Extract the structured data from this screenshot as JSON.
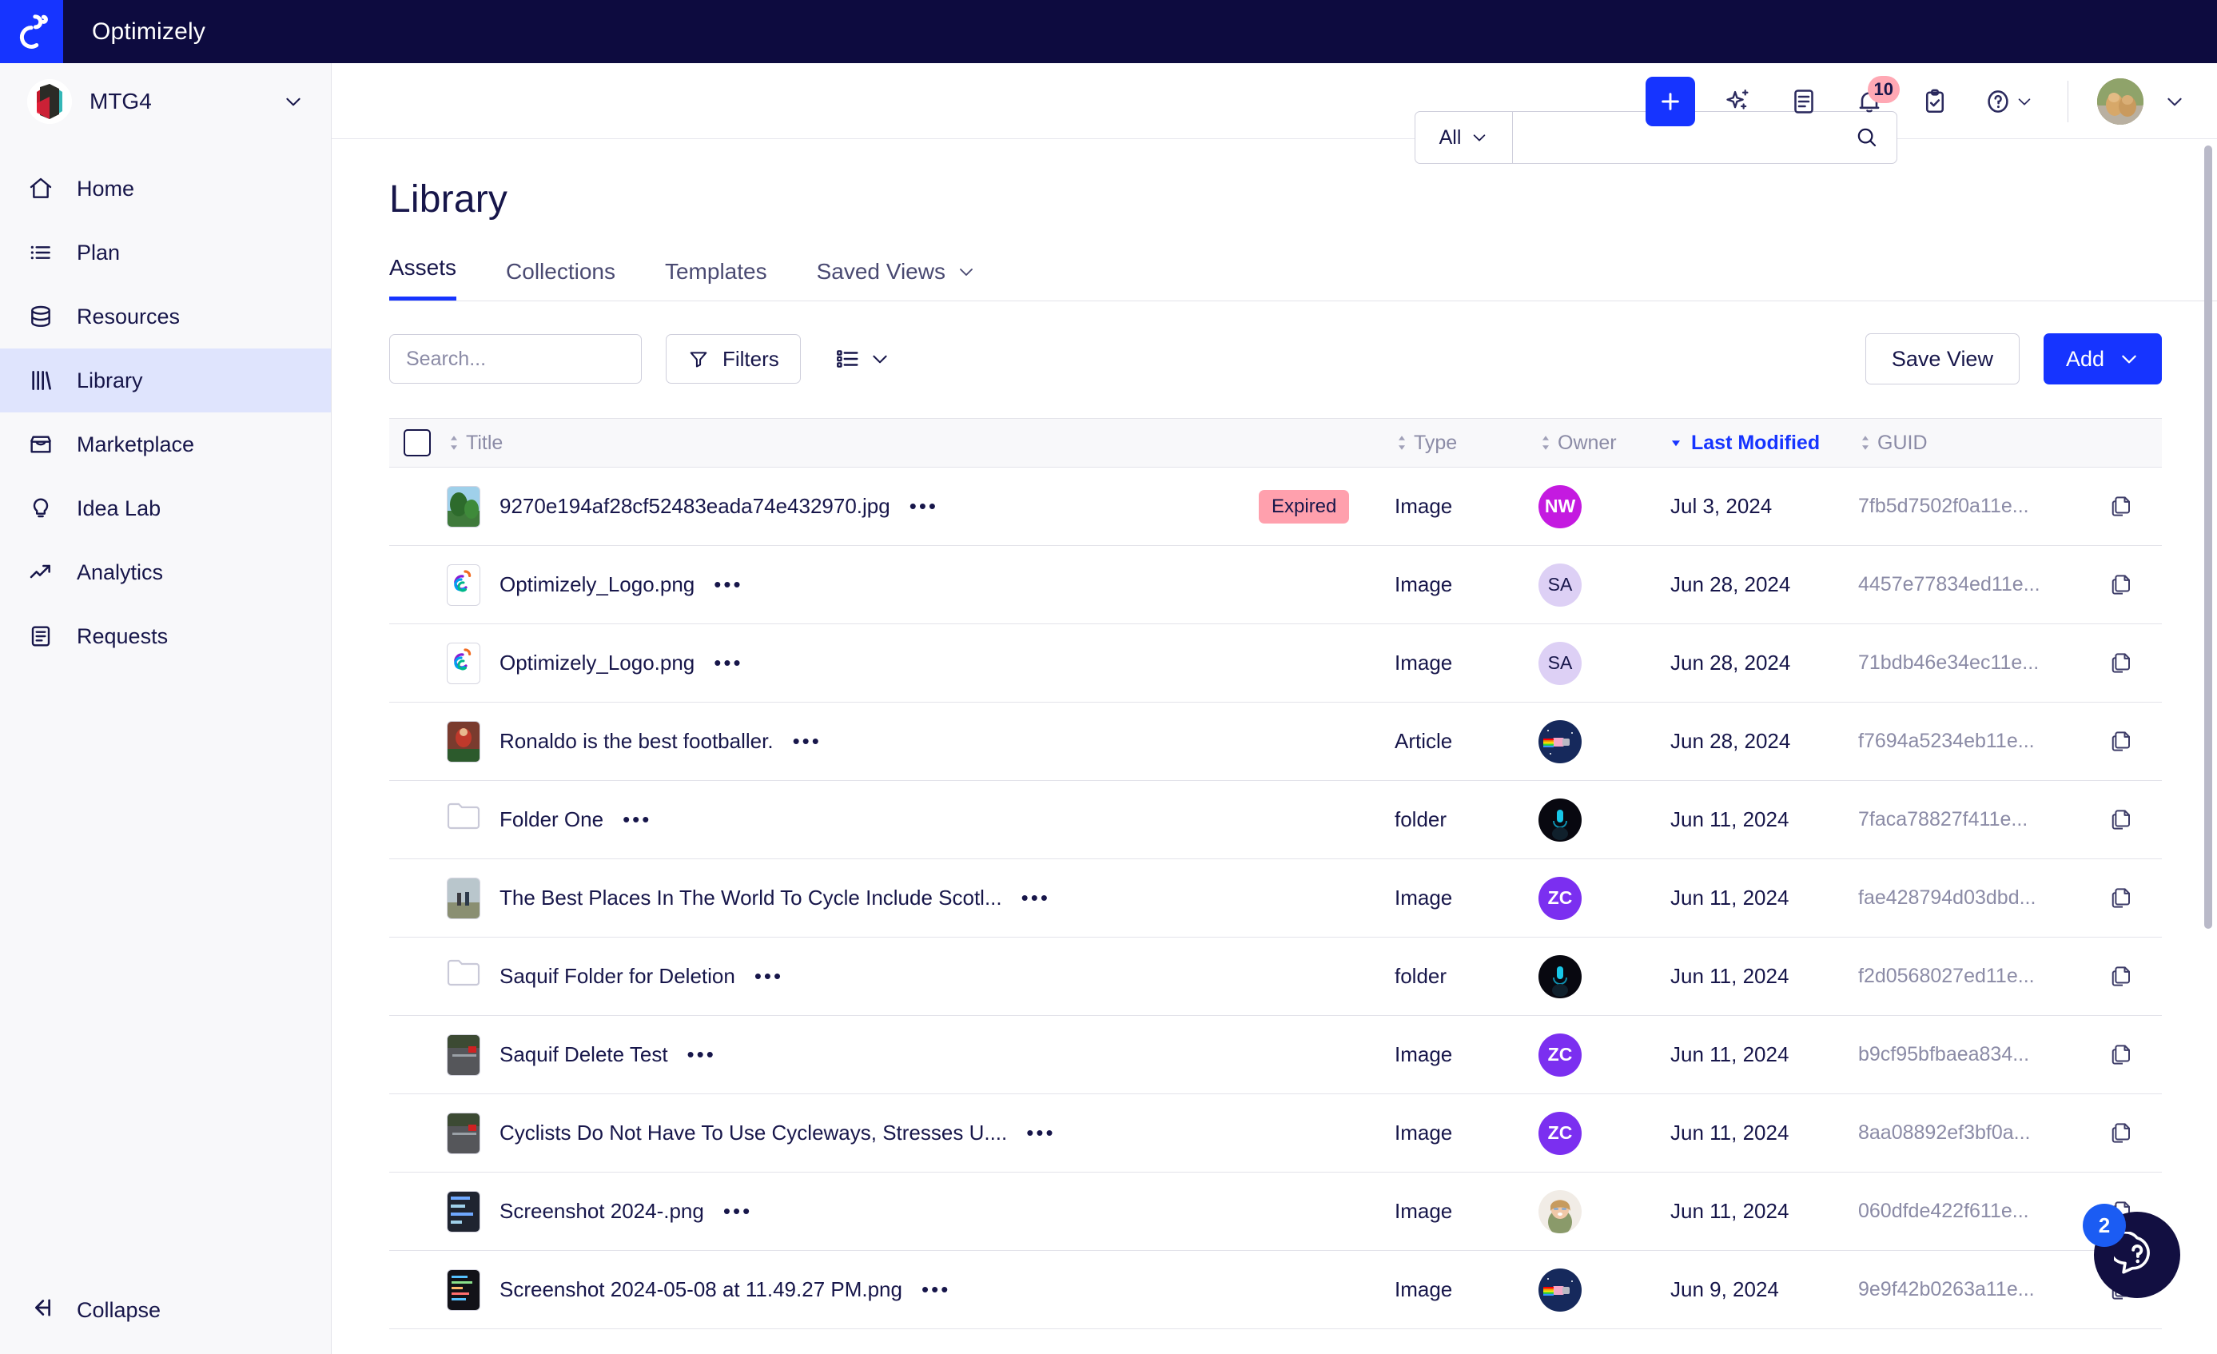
{
  "brand": {
    "name": "Optimizely",
    "logo_icon": "optimizely-logo-icon"
  },
  "org": {
    "name": "MTG4",
    "chevron_icon": "chevron-down-icon",
    "logo_icon": "org-logo-icon"
  },
  "sidebar": {
    "items": [
      {
        "label": "Home",
        "icon": "home-icon",
        "active": false
      },
      {
        "label": "Plan",
        "icon": "list-icon",
        "active": false
      },
      {
        "label": "Resources",
        "icon": "database-icon",
        "active": false
      },
      {
        "label": "Library",
        "icon": "library-icon",
        "active": true
      },
      {
        "label": "Marketplace",
        "icon": "storefront-icon",
        "active": false
      },
      {
        "label": "Idea Lab",
        "icon": "lightbulb-icon",
        "active": false
      },
      {
        "label": "Analytics",
        "icon": "trending-up-icon",
        "active": false
      },
      {
        "label": "Requests",
        "icon": "document-icon",
        "active": false
      }
    ],
    "collapse": {
      "label": "Collapse",
      "icon": "collapse-left-icon"
    }
  },
  "topbar": {
    "search": {
      "scope": "All",
      "value": "",
      "placeholder": "",
      "search_icon": "search-icon",
      "chevron_icon": "chevron-down-icon"
    },
    "actions": [
      {
        "name": "create-button",
        "icon": "plus-icon"
      },
      {
        "name": "ai-assist-button",
        "icon": "sparkle-icon"
      },
      {
        "name": "notes-button",
        "icon": "document-lines-icon"
      },
      {
        "name": "notifications-button",
        "icon": "bell-icon",
        "badge": "10"
      },
      {
        "name": "tasks-button",
        "icon": "clipboard-check-icon"
      },
      {
        "name": "help-menu-button",
        "icon": "question-circle-icon",
        "chevron": "chevron-down-icon"
      }
    ],
    "user": {
      "avatar_icon": "user-avatar",
      "chevron_icon": "chevron-down-icon"
    }
  },
  "page": {
    "title": "Library",
    "tabs": [
      {
        "label": "Assets",
        "active": true
      },
      {
        "label": "Collections",
        "active": false
      },
      {
        "label": "Templates",
        "active": false
      },
      {
        "label": "Saved Views",
        "active": false,
        "chevron": "chevron-down-icon"
      }
    ],
    "toolbar": {
      "search_placeholder": "Search...",
      "search_value": "",
      "search_icon": "search-icon",
      "filters_label": "Filters",
      "filters_icon": "funnel-icon",
      "view_toggle_icon": "list-view-icon",
      "view_toggle_chevron": "chevron-down-icon",
      "save_view_label": "Save View",
      "add_label": "Add",
      "add_chevron": "chevron-down-icon"
    }
  },
  "table": {
    "columns": [
      {
        "key": "title",
        "label": "Title",
        "sortable": true,
        "sorted": false
      },
      {
        "key": "type",
        "label": "Type",
        "sortable": true,
        "sorted": false
      },
      {
        "key": "owner",
        "label": "Owner",
        "sortable": true,
        "sorted": false
      },
      {
        "key": "modified",
        "label": "Last Modified",
        "sortable": true,
        "sorted": true,
        "direction": "desc"
      },
      {
        "key": "guid",
        "label": "GUID",
        "sortable": true,
        "sorted": false
      }
    ],
    "select_all_checked": false,
    "rows": [
      {
        "title": "9270e194af28cf52483eada74e432970.jpg",
        "badge": "Expired",
        "type": "Image",
        "owner_initials": "NW",
        "owner_color": "#c41ae0",
        "owner_photo": false,
        "modified": "Jul 3, 2024",
        "guid": "7fb5d7502f0a11e...",
        "thumb": "photo-tree",
        "is_folder": false
      },
      {
        "title": "Optimizely_Logo.png",
        "badge": "",
        "type": "Image",
        "owner_initials": "SA",
        "owner_color": "#ddd0f5",
        "owner_text_color": "#17164a",
        "owner_photo": false,
        "modified": "Jun 28, 2024",
        "guid": "4457e77834ed11e...",
        "thumb": "logo",
        "is_folder": false
      },
      {
        "title": "Optimizely_Logo.png",
        "badge": "",
        "type": "Image",
        "owner_initials": "SA",
        "owner_color": "#ddd0f5",
        "owner_text_color": "#17164a",
        "owner_photo": false,
        "modified": "Jun 28, 2024",
        "guid": "71bdb46e34ec11e...",
        "thumb": "logo",
        "is_folder": false
      },
      {
        "title": "Ronaldo is the best footballer.",
        "badge": "",
        "type": "Article",
        "owner_initials": "",
        "owner_color": "#16295c",
        "owner_photo": true,
        "owner_photo_kind": "nyan",
        "modified": "Jun 28, 2024",
        "guid": "f7694a5234eb11e...",
        "thumb": "photo-person",
        "is_folder": false
      },
      {
        "title": "Folder One",
        "badge": "",
        "type": "folder",
        "owner_initials": "",
        "owner_color": "#0b0b11",
        "owner_photo": true,
        "owner_photo_kind": "dark",
        "modified": "Jun 11, 2024",
        "guid": "7faca78827f411e...",
        "thumb": "folder",
        "is_folder": true
      },
      {
        "title": "The Best Places In The World To Cycle Include Scotl...",
        "badge": "",
        "type": "Image",
        "owner_initials": "ZC",
        "owner_color": "#7b2ff0",
        "owner_photo": false,
        "modified": "Jun 11, 2024",
        "guid": "fae428794d03dbd...",
        "thumb": "photo-cycle",
        "is_folder": false
      },
      {
        "title": "Saquif Folder for Deletion",
        "badge": "",
        "type": "folder",
        "owner_initials": "",
        "owner_color": "#0b0b11",
        "owner_photo": true,
        "owner_photo_kind": "dark",
        "modified": "Jun 11, 2024",
        "guid": "f2d0568027ed11e...",
        "thumb": "folder",
        "is_folder": true
      },
      {
        "title": "Saquif Delete Test",
        "badge": "",
        "type": "Image",
        "owner_initials": "ZC",
        "owner_color": "#7b2ff0",
        "owner_photo": false,
        "modified": "Jun 11, 2024",
        "guid": "b9cf95bfbaea834...",
        "thumb": "photo-street",
        "is_folder": false
      },
      {
        "title": "Cyclists Do Not Have To Use Cycleways, Stresses U....",
        "badge": "",
        "type": "Image",
        "owner_initials": "ZC",
        "owner_color": "#7b2ff0",
        "owner_photo": false,
        "modified": "Jun 11, 2024",
        "guid": "8aa08892ef3bf0a...",
        "thumb": "photo-street",
        "is_folder": false
      },
      {
        "title": "Screenshot 2024-.png",
        "badge": "",
        "type": "Image",
        "owner_initials": "",
        "owner_color": "#e9ddd2",
        "owner_photo": true,
        "owner_photo_kind": "woman",
        "modified": "Jun 11, 2024",
        "guid": "060dfde422f611e...",
        "thumb": "screenshot-dark",
        "is_folder": false
      },
      {
        "title": "Screenshot 2024-05-08 at 11.49.27 PM.png",
        "badge": "",
        "type": "Image",
        "owner_initials": "",
        "owner_color": "#16295c",
        "owner_photo": true,
        "owner_photo_kind": "nyan",
        "modified": "Jun 9, 2024",
        "guid": "9e9f42b0263a11e...",
        "thumb": "screenshot-code",
        "is_folder": false
      }
    ],
    "copy_icon": "copy-icon"
  },
  "help_widget": {
    "icon": "question-chat-icon",
    "count": "2"
  },
  "colors": {
    "brand_blue": "#1634ff",
    "brand_navy": "#0d0b3f",
    "sidebar_active": "#dfe4fd",
    "expired_badge": "#ffa0ad",
    "sorted_header": "#1634ff"
  }
}
